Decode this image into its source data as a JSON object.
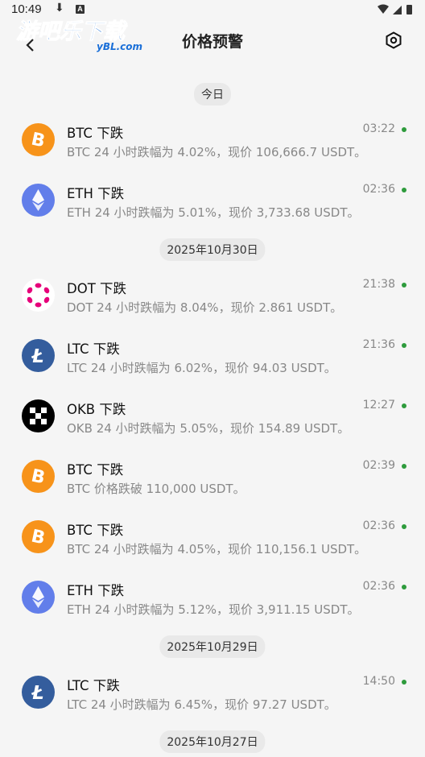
{
  "status_bar": {
    "time": "10:49",
    "download_glyph": "⬇",
    "a_badge": "A"
  },
  "watermark": {
    "brand": "游吧乐下载",
    "site": "yBL.com"
  },
  "header": {
    "title": "价格预警",
    "back_icon": "chevron-left-icon",
    "settings_icon": "hexagon-settings-icon"
  },
  "colors": {
    "dot": "#2e9b3c",
    "btc": "#f7931a",
    "eth": "#627eea",
    "dot_coin": "#e6007a",
    "ltc": "#345d9d",
    "okb": "#000000"
  },
  "sections": [
    {
      "date": "今日",
      "items": [
        {
          "coin": "btc",
          "title": "BTC 下跌",
          "desc": "BTC 24 小时跌幅为 4.02%，现价 106,666.7 USDT。",
          "time": "03:22"
        },
        {
          "coin": "eth",
          "title": "ETH 下跌",
          "desc": "ETH 24 小时跌幅为 5.01%，现价 3,733.68 USDT。",
          "time": "02:36"
        }
      ]
    },
    {
      "date": "2025年10月30日",
      "items": [
        {
          "coin": "dot",
          "title": "DOT 下跌",
          "desc": "DOT 24 小时跌幅为 8.04%，现价 2.861 USDT。",
          "time": "21:38"
        },
        {
          "coin": "ltc",
          "title": "LTC 下跌",
          "desc": "LTC 24 小时跌幅为 6.02%，现价 94.03 USDT。",
          "time": "21:36"
        },
        {
          "coin": "okb",
          "title": "OKB 下跌",
          "desc": "OKB 24 小时跌幅为 5.05%，现价 154.89 USDT。",
          "time": "12:27"
        },
        {
          "coin": "btc",
          "title": "BTC 下跌",
          "desc": "BTC 价格跌破 110,000 USDT。",
          "time": "02:39"
        },
        {
          "coin": "btc",
          "title": "BTC 下跌",
          "desc": "BTC 24 小时跌幅为 4.05%，现价 110,156.1 USDT。",
          "time": "02:36"
        },
        {
          "coin": "eth",
          "title": "ETH 下跌",
          "desc": "ETH 24 小时跌幅为 5.12%，现价 3,911.15 USDT。",
          "time": "02:36"
        }
      ]
    },
    {
      "date": "2025年10月29日",
      "items": [
        {
          "coin": "ltc",
          "title": "LTC 下跌",
          "desc": "LTC 24 小时跌幅为 6.45%，现价 97.27 USDT。",
          "time": "14:50"
        }
      ]
    },
    {
      "date": "2025年10月27日",
      "items": []
    }
  ]
}
